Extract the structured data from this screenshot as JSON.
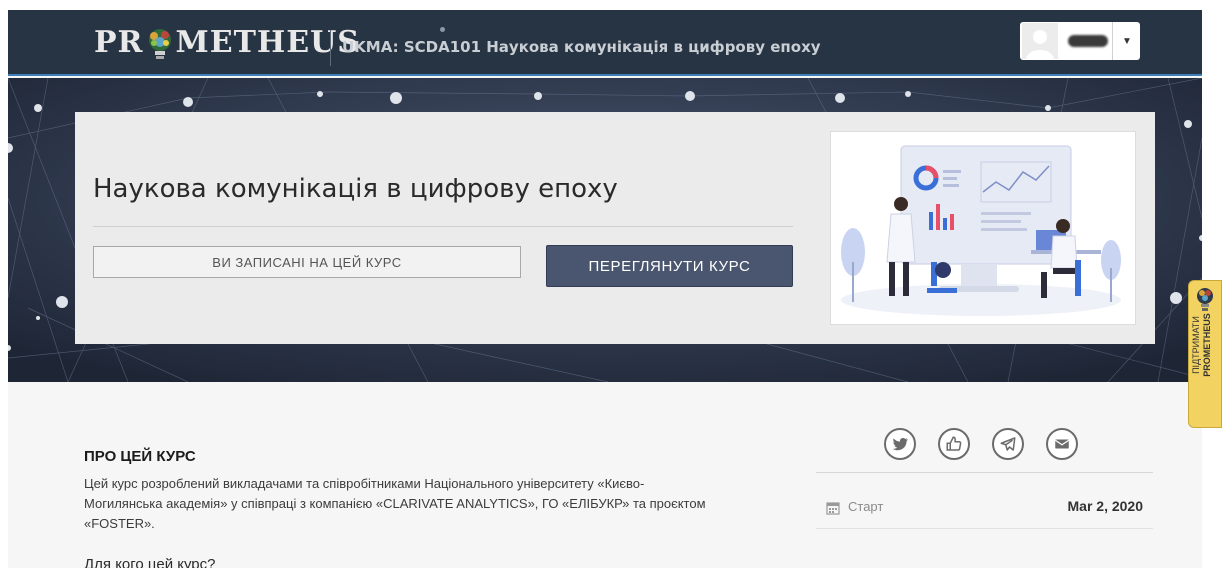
{
  "header": {
    "logo_text_left": "PR",
    "logo_text_right": "METHEUS",
    "course_title": "UKMA: SCDA101 Наукова комунікація в цифрову епоху"
  },
  "hero": {
    "title": "Наукова комунікація в цифрову епоху",
    "enrolled_label": "ВИ ЗАПИСАНІ НА ЦЕЙ КУРС",
    "view_course_label": "ПЕРЕГЛЯНУТИ КУРС"
  },
  "about": {
    "heading": "ПРО ЦЕЙ КУРС",
    "line1": "Цей курс розроблений викладачами та співробітниками Національного університету «Києво-",
    "line2": "Могилянська академія» у співпраці з компанією «CLARIVATE ANALYTICS», ГО «ЕЛІБУКР» та проєктом",
    "line3": "«FOSTER».",
    "for_whom": "Для кого цей курс?"
  },
  "sidebar": {
    "share_icons": [
      "twitter-icon",
      "like-icon",
      "telegram-icon",
      "email-icon"
    ],
    "start_label": "Старт",
    "start_date": "Mar 2, 2020"
  },
  "support_tab": {
    "line1": "ПІДТРИМАТИ",
    "line2": "PROMETHEUS"
  },
  "colors": {
    "header_bg": "#273443",
    "hero_bg": "#34405a",
    "accent_line": "#3f7fb7",
    "view_button": "#4a5670",
    "support_tab": "#f2d361"
  }
}
